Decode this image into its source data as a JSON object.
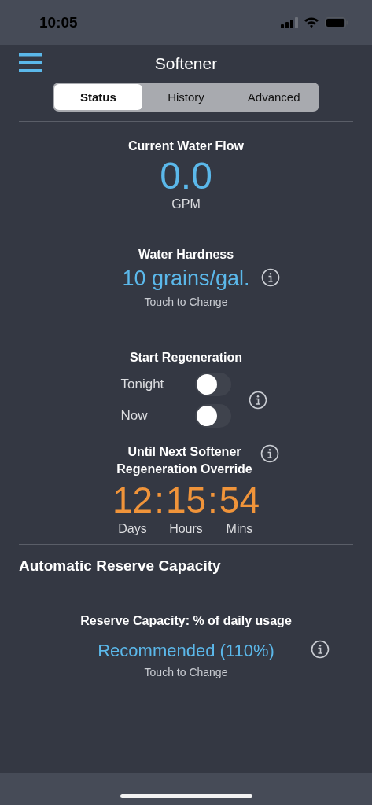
{
  "status_bar": {
    "time": "10:05"
  },
  "header": {
    "title": "Softener"
  },
  "tabs": [
    {
      "label": "Status",
      "selected": true
    },
    {
      "label": "History",
      "selected": false
    },
    {
      "label": "Advanced",
      "selected": false
    }
  ],
  "water_flow": {
    "title": "Current Water Flow",
    "value": "0.0",
    "unit": "GPM"
  },
  "water_hardness": {
    "title": "Water Hardness",
    "value": "10 grains/gal.",
    "hint": "Touch to Change"
  },
  "regeneration": {
    "title": "Start Regeneration",
    "options": [
      {
        "label": "Tonight",
        "on": false
      },
      {
        "label": "Now",
        "on": false
      }
    ]
  },
  "next_regeneration": {
    "title_lines": [
      "Until Next Softener",
      "Regeneration Override"
    ],
    "separator": ":",
    "units": [
      {
        "value": "12",
        "label": "Days"
      },
      {
        "value": "15",
        "label": "Hours"
      },
      {
        "value": "54",
        "label": "Mins"
      }
    ]
  },
  "reserve": {
    "heading": "Automatic Reserve Capacity",
    "title": "Reserve Capacity: % of daily usage",
    "value": "Recommended (110%)",
    "hint": "Touch to Change"
  }
}
